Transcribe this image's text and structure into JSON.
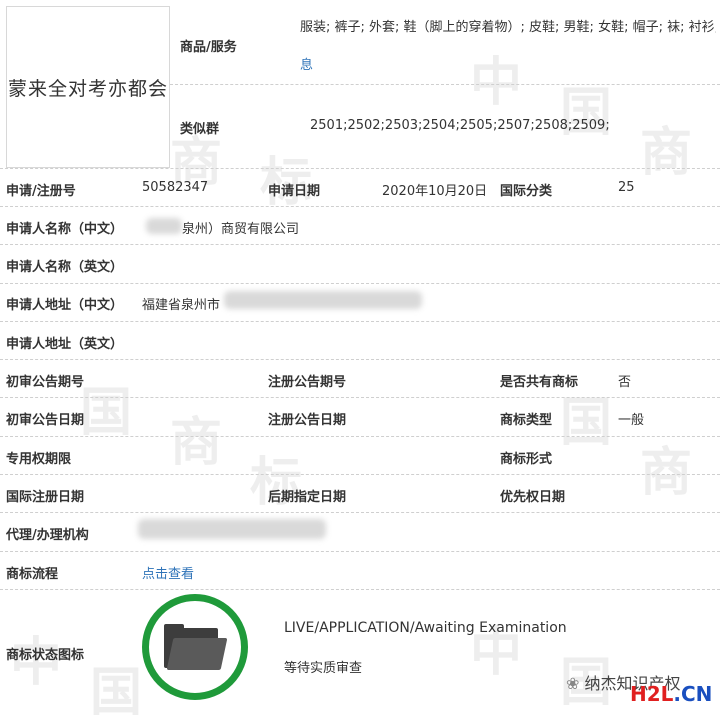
{
  "logo_text": "蒙来全对考亦都会",
  "goods": {
    "label": "商品/服务",
    "value_line1": "服装; 裤子; 外套; 鞋（脚上的穿着物）; 皮鞋; 男鞋; 女鞋; 帽子; 袜; 衬衫;",
    "more_link": "息"
  },
  "similar": {
    "label": "类似群",
    "value": "2501;2502;2503;2504;2505;2507;2508;2509;"
  },
  "row_reg": {
    "reg_no_label": "申请/注册号",
    "reg_no": "50582347",
    "date_label": "申请日期",
    "date": "2020年10月20日",
    "class_label": "国际分类",
    "class": "25"
  },
  "applicant_cn": {
    "label": "申请人名称（中文）",
    "value": "泉州）商贸有限公司"
  },
  "applicant_en": {
    "label": "申请人名称（英文）"
  },
  "address_cn": {
    "label": "申请人地址（中文）",
    "value": "福建省泉州市"
  },
  "address_en": {
    "label": "申请人地址（英文）"
  },
  "row_prelim_no": {
    "label1": "初审公告期号",
    "label2": "注册公告期号",
    "label3": "是否共有商标",
    "value3": "否"
  },
  "row_prelim_date": {
    "label1": "初审公告日期",
    "label2": "注册公告日期",
    "label3": "商标类型",
    "value3": "一般"
  },
  "row_exclusive": {
    "label1": "专用权期限",
    "label3": "商标形式"
  },
  "row_intl": {
    "label1": "国际注册日期",
    "label2": "后期指定日期",
    "label3": "优先权日期"
  },
  "agency": {
    "label": "代理/办理机构"
  },
  "process": {
    "label": "商标流程",
    "link": "点击查看"
  },
  "status": {
    "label": "商标状态图标",
    "en": "LIVE/APPLICATION/Awaiting Examination",
    "cn": "等待实质审查"
  },
  "watermark": {
    "wechat": "纳杰知识产权",
    "site_h2l": "H2L",
    "site_cn": ".CN"
  },
  "colors": {
    "link": "#2e73b8",
    "status_ring": "#1f9a3a",
    "h2l_red": "#e02020",
    "h2l_blue": "#1a4fbf"
  }
}
